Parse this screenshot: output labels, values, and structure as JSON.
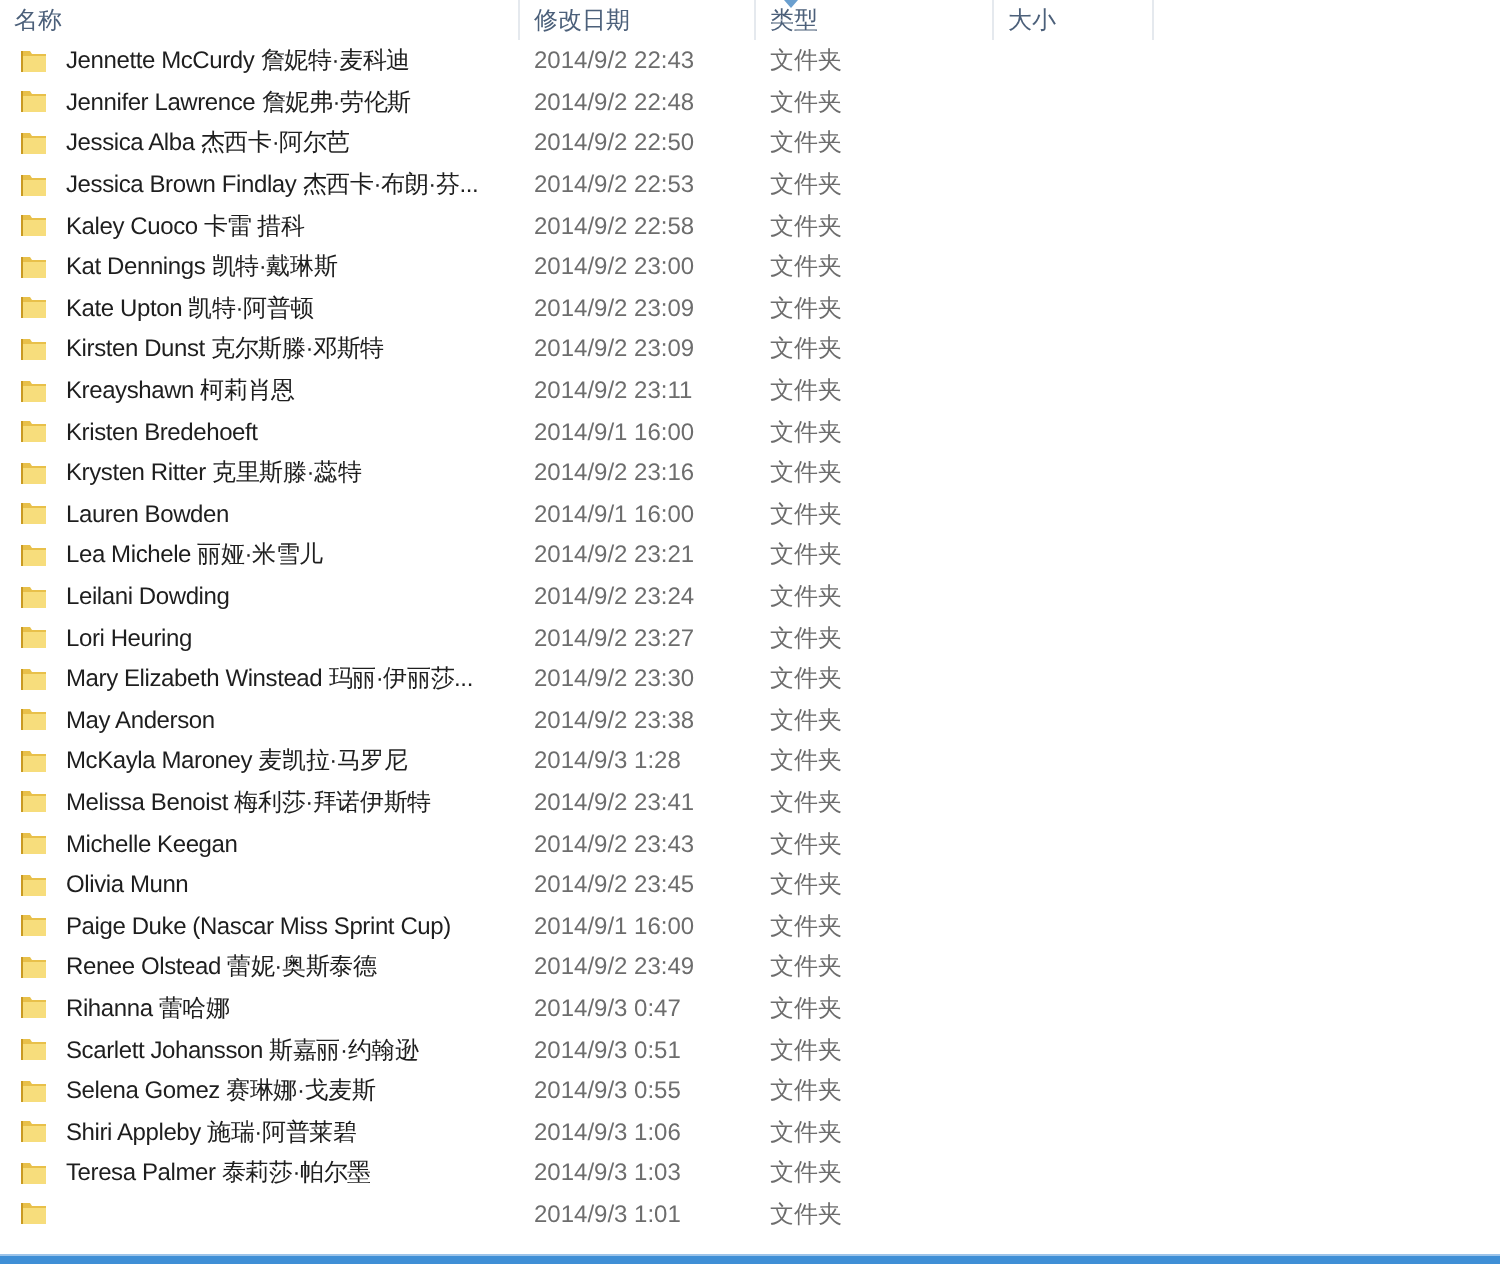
{
  "columns": [
    "名称",
    "修改日期",
    "类型",
    "大小"
  ],
  "rows": [
    {
      "name": "Jennette McCurdy 詹妮特·麦科迪",
      "modified": "2014/9/2 22:43",
      "type": "文件夹"
    },
    {
      "name": "Jennifer Lawrence 詹妮弗·劳伦斯",
      "modified": "2014/9/2 22:48",
      "type": "文件夹"
    },
    {
      "name": "Jessica Alba 杰西卡·阿尔芭",
      "modified": "2014/9/2 22:50",
      "type": "文件夹"
    },
    {
      "name": "Jessica Brown Findlay 杰西卡·布朗·芬...",
      "modified": "2014/9/2 22:53",
      "type": "文件夹"
    },
    {
      "name": "Kaley Cuoco 卡雷 措科",
      "modified": "2014/9/2 22:58",
      "type": "文件夹"
    },
    {
      "name": "Kat Dennings 凯特·戴琳斯",
      "modified": "2014/9/2 23:00",
      "type": "文件夹"
    },
    {
      "name": "Kate Upton 凯特·阿普顿",
      "modified": "2014/9/2 23:09",
      "type": "文件夹"
    },
    {
      "name": "Kirsten Dunst 克尔斯滕·邓斯特",
      "modified": "2014/9/2 23:09",
      "type": "文件夹"
    },
    {
      "name": "Kreayshawn 柯莉肖恩",
      "modified": "2014/9/2 23:11",
      "type": "文件夹"
    },
    {
      "name": "Kristen Bredehoeft",
      "modified": "2014/9/1 16:00",
      "type": "文件夹"
    },
    {
      "name": "Krysten Ritter 克里斯滕·蕊特",
      "modified": "2014/9/2 23:16",
      "type": "文件夹"
    },
    {
      "name": "Lauren Bowden",
      "modified": "2014/9/1 16:00",
      "type": "文件夹"
    },
    {
      "name": "Lea Michele 丽娅·米雪儿",
      "modified": "2014/9/2 23:21",
      "type": "文件夹"
    },
    {
      "name": "Leilani Dowding",
      "modified": "2014/9/2 23:24",
      "type": "文件夹"
    },
    {
      "name": "Lori Heuring",
      "modified": "2014/9/2 23:27",
      "type": "文件夹"
    },
    {
      "name": "Mary Elizabeth Winstead 玛丽·伊丽莎...",
      "modified": "2014/9/2 23:30",
      "type": "文件夹"
    },
    {
      "name": "May Anderson",
      "modified": "2014/9/2 23:38",
      "type": "文件夹"
    },
    {
      "name": "McKayla Maroney 麦凯拉·马罗尼",
      "modified": "2014/9/3 1:28",
      "type": "文件夹"
    },
    {
      "name": "Melissa Benoist 梅利莎·拜诺伊斯特",
      "modified": "2014/9/2 23:41",
      "type": "文件夹"
    },
    {
      "name": "Michelle Keegan",
      "modified": "2014/9/2 23:43",
      "type": "文件夹"
    },
    {
      "name": "Olivia Munn",
      "modified": "2014/9/2 23:45",
      "type": "文件夹"
    },
    {
      "name": "Paige Duke (Nascar Miss Sprint Cup)",
      "modified": "2014/9/1 16:00",
      "type": "文件夹"
    },
    {
      "name": "Renee Olstead 蕾妮·奥斯泰德",
      "modified": "2014/9/2 23:49",
      "type": "文件夹"
    },
    {
      "name": "Rihanna 蕾哈娜",
      "modified": "2014/9/3 0:47",
      "type": "文件夹"
    },
    {
      "name": "Scarlett Johansson 斯嘉丽·约翰逊",
      "modified": "2014/9/3 0:51",
      "type": "文件夹"
    },
    {
      "name": "Selena Gomez 赛琳娜·戈麦斯",
      "modified": "2014/9/3 0:55",
      "type": "文件夹"
    },
    {
      "name": "Shiri Appleby 施瑞·阿普莱碧",
      "modified": "2014/9/3 1:06",
      "type": "文件夹"
    },
    {
      "name": "Teresa Palmer 泰莉莎·帕尔墨",
      "modified": "2014/9/3 1:03",
      "type": "文件夹"
    },
    {
      "modified": "2014/9/3 1:01",
      "type": "文件夹"
    }
  ]
}
